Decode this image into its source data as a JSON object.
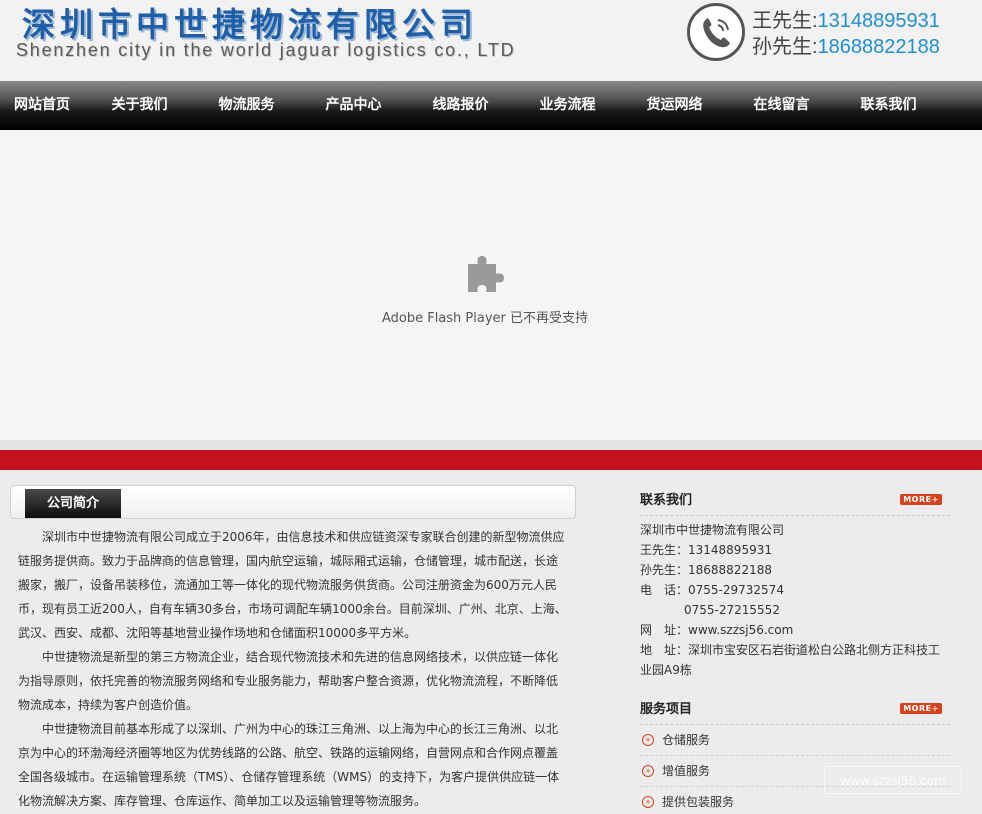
{
  "header": {
    "logo_cn": "深圳市中世捷物流有限公司",
    "logo_en": "Shenzhen city in the world jaguar logistics co., LTD",
    "phones": [
      {
        "name": "王先生:",
        "number": "13148895931"
      },
      {
        "name": "孙先生:",
        "number": "18688822188"
      }
    ]
  },
  "nav": {
    "items": [
      "网站首页",
      "关于我们",
      "物流服务",
      "产品中心",
      "线路报价",
      "业务流程",
      "货运网络",
      "在线留言",
      "联系我们"
    ]
  },
  "flash": {
    "message": "Adobe Flash Player 已不再受支持"
  },
  "intro": {
    "title": "公司简介",
    "paragraphs": [
      "深圳市中世捷物流有限公司成立于2006年，由信息技术和供应链资深专家联合创建的新型物流供应链服务提供商。致力于品牌商的信息管理，国内航空运输，城际厢式运输，仓储管理，城市配送，长途搬家，搬厂，设备吊装移位，流通加工等一体化的现代物流服务供货商。公司注册资金为600万元人民币，现有员工近200人，自有车辆30多台，市场可调配车辆1000余台。目前深圳、广州、北京、上海、武汉、西安、成都、沈阳等基地营业操作场地和仓储面积10000多平方米。",
      "中世捷物流是新型的第三方物流企业，结合现代物流技术和先进的信息网络技术，以供应链一体化为指导原则，依托完善的物流服务网络和专业服务能力，帮助客户整合资源，优化物流流程，不断降低物流成本，持续为客户创造价值。",
      "中世捷物流目前基本形成了以深圳、广州为中心的珠江三角洲、以上海为中心的长江三角洲、以北京为中心的环渤海经济圈等地区为优势线路的公路、航空、铁路的运输网络，自营网点和合作网点覆盖全国各级城市。在运输管理系统（TMS）、仓储存管理系统（WMS）的支持下，为客户提供供应链一体化物流解决方案、库存管理、仓库运作、简单加工以及运输管理等物流服务。"
    ]
  },
  "contact": {
    "title": "联系我们",
    "more": "MORE+",
    "company": "深圳市中世捷物流有限公司",
    "person1": "王先生：13148895931",
    "person2": "孙先生：18688822188",
    "tel1": "电　话：0755-29732574",
    "tel2": "0755-27215552",
    "web": "网　址：www.szzsj56.com",
    "address": "地　址：深圳市宝安区石岩街道松白公路北侧方正科技工业园A9栋"
  },
  "services": {
    "title": "服务项目",
    "more": "MORE+",
    "items": [
      "仓储服务",
      "增值服务",
      "提供包装服务"
    ]
  },
  "watermark": "www.szzsj56.com"
}
